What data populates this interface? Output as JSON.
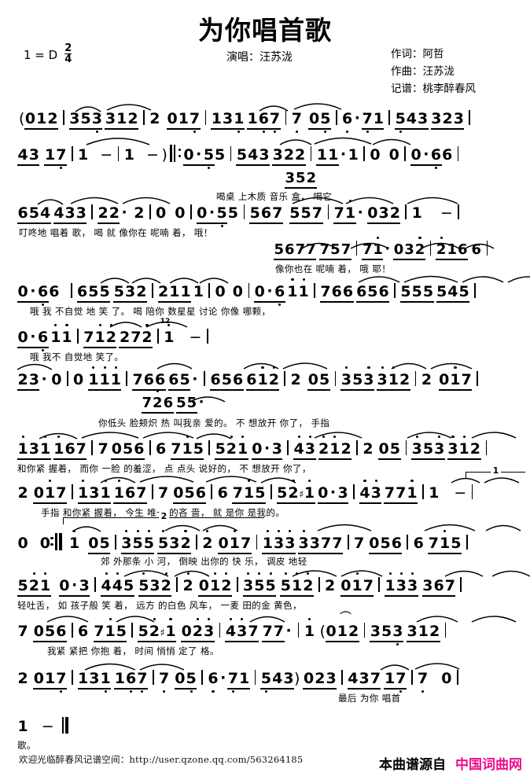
{
  "header": {
    "title": "为你唱首歌",
    "key_label": "1 = D",
    "meter_num": "2",
    "meter_den": "4",
    "singer": "演唱：汪苏泷",
    "credits": [
      "作词：阿哲",
      "作曲：汪苏泷",
      "记谱：桃李醉春风"
    ]
  },
  "footer": {
    "url_note": "欢迎光临醉春风记谱空间：http://user.qzone.qq.com/563264185",
    "source_prefix": "本曲谱源自",
    "source_site": "中国词曲网",
    "source_color": "#ef0d8c"
  },
  "score": {
    "systems": [
      {
        "id": "sys1",
        "notes": "( 0 1 2 | 3 5 3  3 1 2 | 2   0 1 7 | 1 3 1  1 6 7 | 7  0 5 | 6 · 7 1 | 5 4 3  3 2 3 |",
        "lyrics": ""
      },
      {
        "id": "sys2",
        "notes": "4 3  1 7 | 1  −  | 1  − ) ‖: 0 · 5  5 | 5 4 3  3 2 2 | 1 1 ·  1 | 0  0 | 0 · 6  6 |",
        "ossia": "3 5 2",
        "lyrics": "喝桌  上木质  音乐   盒，          喝它"
      },
      {
        "id": "sys3",
        "notes": "6 5 4  4 3 3 | 2 2 ·  2 | 0  0 | 0 · 5  5 | 5 6 7  5 5 7 | 7 1 ·  0 3 2 | 1   − |",
        "lyrics": "叮咚地  唱着   歌，            喝 就   像你在   呢喃    着， 哦！",
        "ossia": "5 6 7 7  7 5 7 | 7 1 ·  0 3 2 | 2 1 6  6 |",
        "ossia_lyrics": "像你也在   呢喃    着，  哦     耶！"
      },
      {
        "id": "sys4",
        "notes": "0 · 6  6 | 6 5 5  5 3 2 | 2 1 1  1 | 0  0 | 0 · 6  1 1 | 7 6 6  6 5 6 | 5 5 5  5 4 5 |",
        "lyrics": "哦 我   不自觉 地   笑 了。        喝 陪你   数星星  讨论    你像  哪颗，"
      },
      {
        "id": "sys5",
        "notes": "0 · 6  1 1 | 7 1 2  2 7 2 | 1 1   − |",
        "lyrics": "哦 我不   自觉地   笑了。",
        "marking": "12"
      },
      {
        "id": "sys6",
        "notes": "2 3 ·  0 | 0 1 1 1 | 7 6 6  6 5 · | 6 5 6  6 1 2 | 2  0 5 | 3 5 3  3 1 2 | 2  0 1 7 |",
        "ossia": "7 2 6  5 5 ·",
        "lyrics": "你低头   脸颊炽  热    叫我亲  爱的。     不   想放开  你了，      手指"
      },
      {
        "id": "sys7",
        "notes": "1 3 1  1 6 7 | 7 0 5 6 | 6  7 1 5 | 5 2 1  0 · 3 | 4 3  2 1 2 | 2  0 5 | 3 5 3  3 1 2 |",
        "lyrics": "和你紧  握着，    而你    一脸    的羞涩，  点   点头 说好的，    不   想放开  你了，"
      },
      {
        "id": "sys8",
        "notes": "2  0 1 7 | 1 3 1  1 6 7 | 7  0 5 6 | 6  7 1 5 | 5 2 #1  0 · 3 | 4 3  7 7 1 | 1   − |",
        "lyrics": "手指   和你紧  握着，   今生    唯一    的吝 啬，  就   是你 是我的。",
        "ending": "1"
      },
      {
        "id": "sys9",
        "notes": "0   0 :‖ 1  0 5 | 3 5 5  5 3 2 | 2  0 1 7 | 1 3 3  3 3 7 7 | 7  0 5 6 | 6  7 1 5 |",
        "lyrics": "郊    外那条   小    河， 倒映  出你的  快 乐，    调皮    地轻",
        "ending": "2"
      },
      {
        "id": "sys10",
        "notes": "5 2 1   0 · 3 | 4 4 5  5 3 2 | 2  0 1 2 | 3 5 5  5 1 2 | 2  0 1 7 | 1 3 3  3 6 7 |",
        "lyrics": "轻吐舌，   如  孩子般  笑   着， 远方   的白色   风车，    一麦   田的金   黄色，"
      },
      {
        "id": "sys11",
        "notes": "7  0 5 6 | 6  7 1 5 | 5 2 #1  0 2 3 | 4 3 7  7 7 · | 1 ( 0 1 2 | 3 5 3  3 1 2 |",
        "lyrics": "我紧    紧把    你抱 着，  时间   悄悄  定了   格。"
      },
      {
        "id": "sys12",
        "notes": "2  0 1 7 | 1 3 1  1 6 7 | 7  0 5 | 6 · 7 1 | 5 4 3 ) 0 2 3 | 4 3 7  1 7 | 7   0 |",
        "lyrics": "最后   为你   唱首"
      },
      {
        "id": "sys13",
        "notes": "1   − ‖",
        "lyrics": "歌。"
      }
    ]
  }
}
